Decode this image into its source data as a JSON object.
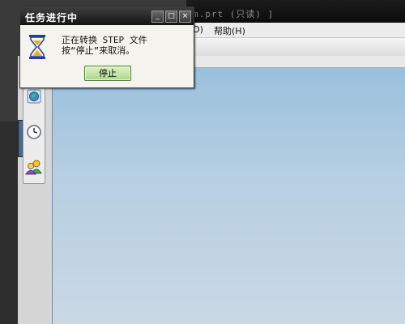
{
  "app": {
    "title_fragment": "m.prt (只读) ]",
    "menu": [
      {
        "label": "O)"
      },
      {
        "label": "帮助(H)"
      }
    ]
  },
  "side_tabs": [
    {
      "icon": "globe-icon"
    },
    {
      "icon": "history-clock-icon"
    },
    {
      "icon": "users-icon"
    }
  ],
  "dialog": {
    "title": "任务进行中",
    "minimize": "_",
    "maximize": "□",
    "close": "×",
    "message_line1": "正在转换 STEP 文件",
    "message_line2": "按“停止”来取消。",
    "stop_label": "停止",
    "icon": "hourglass-icon"
  },
  "colors": {
    "title_bar": "#1a1a1a",
    "graphics_top": "#97bedd",
    "graphics_bottom": "#cad8e4",
    "stop_button": "#b8dd98"
  }
}
